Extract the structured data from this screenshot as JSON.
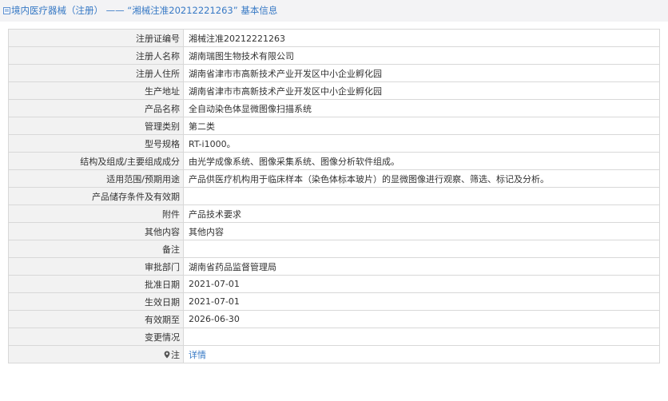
{
  "header": {
    "title": "境内医疗器械（注册） —— “湘械注准20212221263” 基本信息",
    "icon": "doc-icon"
  },
  "rows": [
    {
      "label": "注册证编号",
      "value": "湘械注准20212221263"
    },
    {
      "label": "注册人名称",
      "value": "湖南瑞图生物技术有限公司"
    },
    {
      "label": "注册人住所",
      "value": "湖南省津市市高新技术产业开发区中小企业孵化园"
    },
    {
      "label": "生产地址",
      "value": "湖南省津市市高新技术产业开发区中小企业孵化园"
    },
    {
      "label": "产品名称",
      "value": "全自动染色体显微图像扫描系统"
    },
    {
      "label": "管理类别",
      "value": "第二类"
    },
    {
      "label": "型号规格",
      "value": "RT-i1000。"
    },
    {
      "label": "结构及组成/主要组成成分",
      "value": "由光学成像系统、图像采集系统、图像分析软件组成。"
    },
    {
      "label": "适用范围/预期用途",
      "value": "产品供医疗机构用于临床样本（染色体标本玻片）的显微图像进行观察、筛选、标记及分析。"
    },
    {
      "label": "产品储存条件及有效期",
      "value": ""
    },
    {
      "label": "附件",
      "value": "产品技术要求"
    },
    {
      "label": "其他内容",
      "value": "其他内容"
    },
    {
      "label": "备注",
      "value": ""
    },
    {
      "label": "审批部门",
      "value": "湖南省药品监督管理局"
    },
    {
      "label": "批准日期",
      "value": "2021-07-01"
    },
    {
      "label": "生效日期",
      "value": "2021-07-01"
    },
    {
      "label": "有效期至",
      "value": "2026-06-30"
    },
    {
      "label": "变更情况",
      "value": ""
    }
  ],
  "footer_row": {
    "label": "注",
    "icon": "location-pin-icon",
    "link_text": "详情"
  },
  "colors": {
    "header_bg": "#f3f3f5",
    "title_blue": "#3779c5",
    "label_bg": "#f2f2f2",
    "border": "#d8d8d8"
  }
}
